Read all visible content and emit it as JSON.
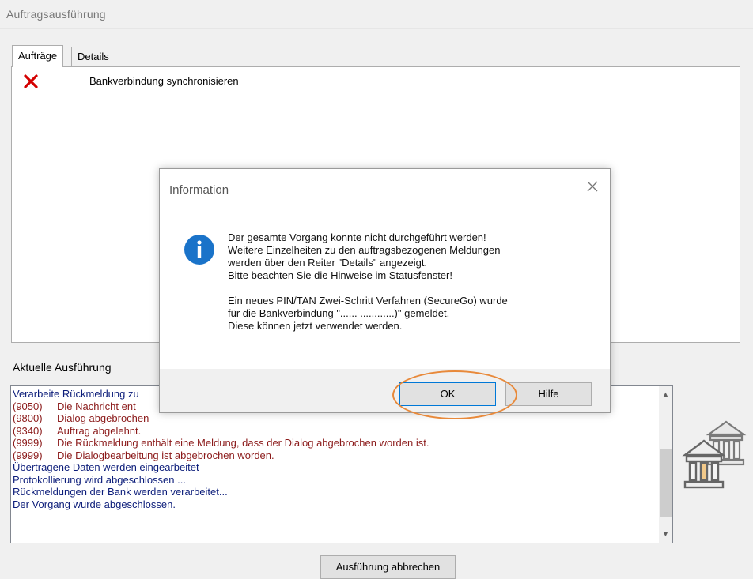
{
  "window": {
    "title": "Auftragsausführung"
  },
  "tabs": [
    {
      "label": "Aufträge",
      "active": true
    },
    {
      "label": "Details",
      "active": false
    }
  ],
  "orders": [
    {
      "status_icon": "red-x-icon",
      "label": "Bankverbindung synchronisieren"
    }
  ],
  "execution": {
    "section_label": "Aktuelle Ausführung",
    "log": [
      {
        "code": "",
        "text": "Verarbeite Rückmeldung zu",
        "type": "info"
      },
      {
        "code": "(9050)",
        "text": "Die Nachricht ent",
        "type": "error"
      },
      {
        "code": "(9800)",
        "text": "Dialog abgebrochen",
        "type": "error"
      },
      {
        "code": "(9340)",
        "text": "Auftrag abgelehnt.",
        "type": "error"
      },
      {
        "code": "(9999)",
        "text": "Die Rückmeldung enthält eine Meldung, dass der Dialog abgebrochen worden ist.",
        "type": "error"
      },
      {
        "code": "(9999)",
        "text": "Die Dialogbearbeitung ist abgebrochen worden.",
        "type": "error"
      },
      {
        "code": "",
        "text": "Übertragene Daten werden eingearbeitet",
        "type": "info"
      },
      {
        "code": "",
        "text": "Protokollierung wird abgeschlossen ...",
        "type": "info"
      },
      {
        "code": "",
        "text": "Rückmeldungen der Bank werden verarbeitet...",
        "type": "info"
      },
      {
        "code": "",
        "text": "Der Vorgang wurde abgeschlossen.",
        "type": "info"
      }
    ],
    "cancel_button": "Ausführung abbrechen"
  },
  "dialog": {
    "title": "Information",
    "icon": "info-icon",
    "message_lines": [
      "Der gesamte Vorgang konnte nicht durchgeführt werden!",
      "Weitere Einzelheiten zu den auftragsbezogenen Meldungen",
      "werden über den Reiter \"Details\" angezeigt.",
      "Bitte beachten Sie die Hinweise im Statusfenster!"
    ],
    "message_lines_2": [
      "Ein neues PIN/TAN Zwei-Schritt Verfahren (SecureGo) wurde",
      "für die Bankverbindung \"...... ............)\" gemeldet.",
      "Diese können jetzt verwendet werden."
    ],
    "ok_button": "OK",
    "help_button": "Hilfe"
  },
  "colors": {
    "info_text": "#0c1d7a",
    "error_text": "#8b1a1a",
    "highlight": "#e8893a",
    "info_icon": "#1a73c9"
  }
}
